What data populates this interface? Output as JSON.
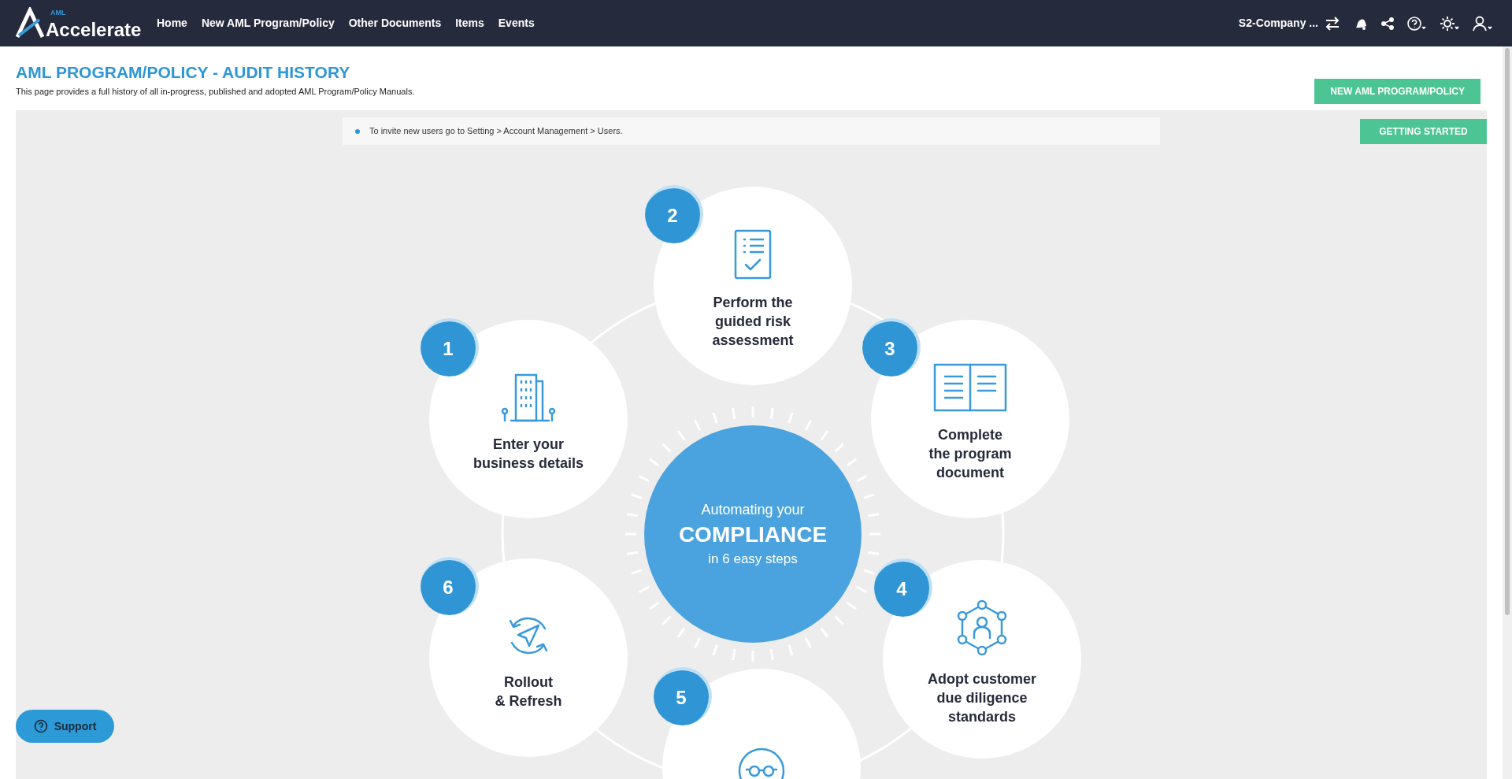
{
  "header": {
    "logo": {
      "small": "AML",
      "main": "Accelerate"
    },
    "nav": [
      "Home",
      "New AML Program/Policy",
      "Other Documents",
      "Items",
      "Events"
    ],
    "company": "S2-Company ..."
  },
  "page": {
    "title": "AML PROGRAM/POLICY - AUDIT HISTORY",
    "subtitle": "This page provides a full history of all in-progress, published and adopted AML Program/Policy Manuals.",
    "action": "NEW AML PROGRAM/POLICY"
  },
  "notice": "To invite new users go to Setting > Account Management > Users.",
  "getting_started": "GETTING STARTED",
  "infographic": {
    "center": {
      "line1": "Automating your",
      "line2": "COMPLIANCE",
      "line3": "in 6 easy steps"
    },
    "steps": [
      {
        "number": "2",
        "kind": "checklist",
        "label": "Perform the\nguided risk\nassessment"
      },
      {
        "number": "1",
        "kind": "building",
        "label": "Enter your\nbusiness details"
      },
      {
        "number": "3",
        "kind": "book",
        "label": "Complete\nthe program\ndocument"
      },
      {
        "number": "6",
        "kind": "send",
        "label": "Rollout\n& Refresh"
      },
      {
        "number": "4",
        "kind": "network",
        "label": "Adopt customer\ndue diligence\nstandards"
      },
      {
        "number": "5",
        "kind": "glasses"
      }
    ]
  },
  "support": "Support"
}
